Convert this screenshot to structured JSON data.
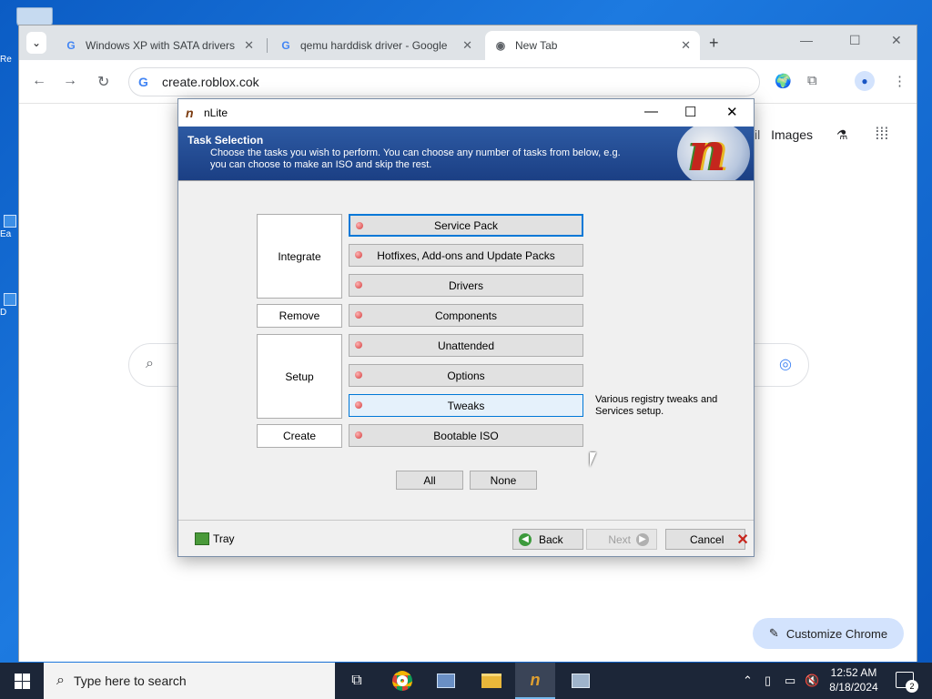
{
  "desktop": {
    "icon_labels": [
      "Re",
      "Ea",
      "D"
    ]
  },
  "browser": {
    "tabs": [
      {
        "title": "Windows XP with SATA drivers",
        "favicon": "google-icon",
        "active": false
      },
      {
        "title": "qemu harddisk driver - Google",
        "favicon": "google-icon",
        "active": false
      },
      {
        "title": "New Tab",
        "favicon": "chrome-icon",
        "active": true
      }
    ],
    "address": "create.roblox.cok",
    "google": {
      "images_link": "Images",
      "partial_link": "il"
    },
    "customize_label": "Customize Chrome"
  },
  "dialog": {
    "title": "nLite",
    "header_title": "Task Selection",
    "header_text": "Choose the tasks you wish to perform. You can choose any number of tasks from below, e.g. you can choose to make an ISO and skip the rest.",
    "categories": [
      "Integrate",
      "Remove",
      "Setup",
      "Create"
    ],
    "tasks": [
      "Service Pack",
      "Hotfixes, Add-ons and Update Packs",
      "Drivers",
      "Components",
      "Unattended",
      "Options",
      "Tweaks",
      "Bootable ISO"
    ],
    "description": "Various registry tweaks and Services setup.",
    "all_label": "All",
    "none_label": "None",
    "tray_label": "Tray",
    "back_label": "Back",
    "next_label": "Next",
    "cancel_label": "Cancel",
    "colors": {
      "header": "#1b3f84",
      "selected_border": "#0078d7",
      "dot": "#d23b3b"
    }
  },
  "taskbar": {
    "search_placeholder": "Type here to search",
    "time": "12:52 AM",
    "date": "8/18/2024",
    "notification_count": "2"
  }
}
